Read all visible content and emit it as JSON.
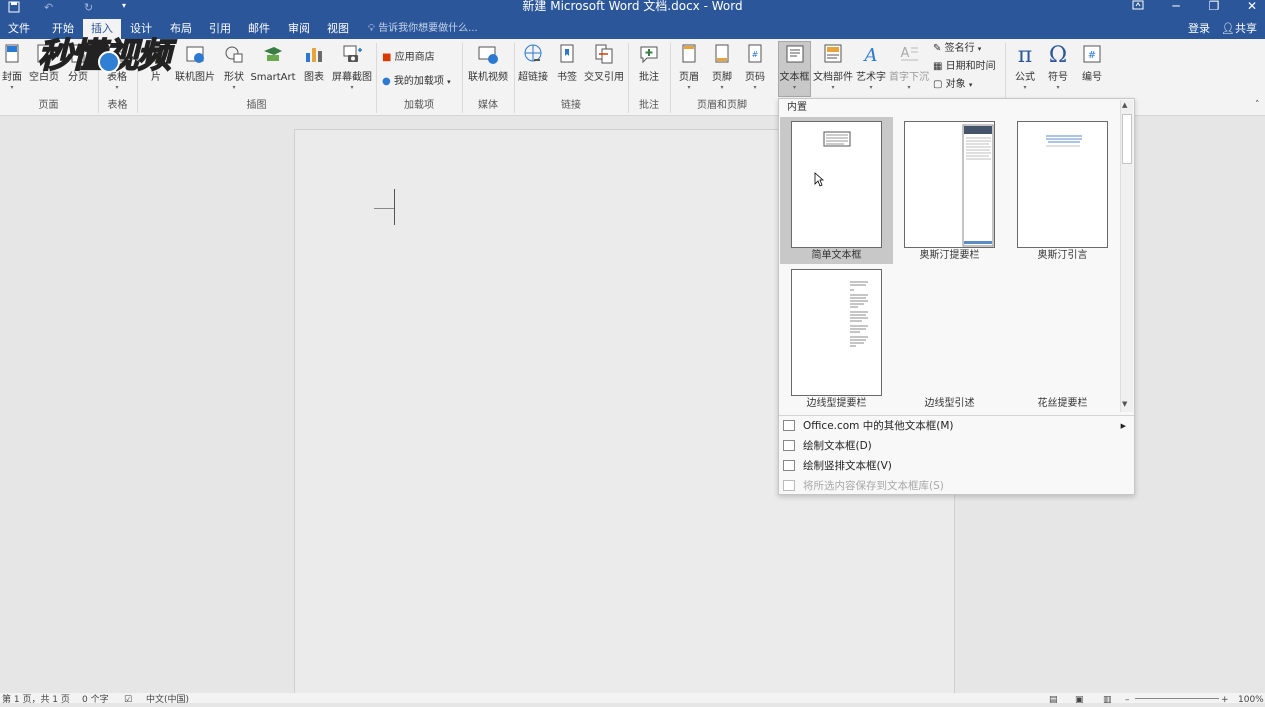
{
  "title_bar": {
    "title": "新建 Microsoft Word 文档.docx - Word",
    "qat_icons": [
      "save-icon",
      "undo-icon",
      "redo-icon",
      "customize-qat-icon"
    ],
    "window_controls": [
      "ribbon-display-icon",
      "minimize-icon",
      "restore-icon",
      "close-icon"
    ]
  },
  "tabs": [
    {
      "label": "文件"
    },
    {
      "label": "开始"
    },
    {
      "label": "插入",
      "active": true
    },
    {
      "label": "设计"
    },
    {
      "label": "布局"
    },
    {
      "label": "引用"
    },
    {
      "label": "邮件"
    },
    {
      "label": "审阅"
    },
    {
      "label": "视图"
    }
  ],
  "tell_me": "告诉我你想要做什么...",
  "account": {
    "login": "登录",
    "share": "共享"
  },
  "ribbon": {
    "buttons": {
      "cover": "封面",
      "blank": "空白页",
      "pagebreak": "分页",
      "table": "表格",
      "pictures": "片",
      "online_pictures": "联机图片",
      "shapes": "形状",
      "smartart": "SmartArt",
      "chart": "图表",
      "screenshot": "屏幕截图",
      "store": "应用商店",
      "my_addins": "我的加载项",
      "online_video": "联机视频",
      "hyperlink": "超链接",
      "bookmark": "书签",
      "cross_ref": "交叉引用",
      "comment": "批注",
      "header": "页眉",
      "footer": "页脚",
      "page_number": "页码",
      "textbox": "文本框",
      "quick_parts": "文档部件",
      "wordart": "艺术字",
      "dropcap": "首字下沉",
      "signature": "签名行",
      "datetime": "日期和时间",
      "object": "对象",
      "equation": "公式",
      "symbol": "符号",
      "number": "编号"
    },
    "groups": {
      "pages": "页面",
      "tables": "表格",
      "illustrations": "插图",
      "addins": "加载项",
      "media": "媒体",
      "links": "链接",
      "comments": "批注",
      "header_footer": "页眉和页脚"
    }
  },
  "gallery": {
    "section_header": "内置",
    "items": [
      {
        "label": "简单文本框",
        "selected": true
      },
      {
        "label": "奥斯汀提要栏"
      },
      {
        "label": "奥斯汀引言"
      },
      {
        "label": "边线型提要栏"
      },
      {
        "label": "边线型引述"
      },
      {
        "label": "花丝提要栏"
      }
    ],
    "menu": [
      {
        "label": "Office.com 中的其他文本框(M)",
        "submenu": true
      },
      {
        "label": "绘制文本框(D)"
      },
      {
        "label": "绘制竖排文本框(V)"
      },
      {
        "label": "将所选内容保存到文本框库(S)",
        "disabled": true
      }
    ]
  },
  "status_bar": {
    "page": "第 1 页，共 1 页",
    "words": "0 个字",
    "language": "中文(中国)",
    "zoom": "100%"
  },
  "watermark": {
    "text": "秒懂视频"
  }
}
